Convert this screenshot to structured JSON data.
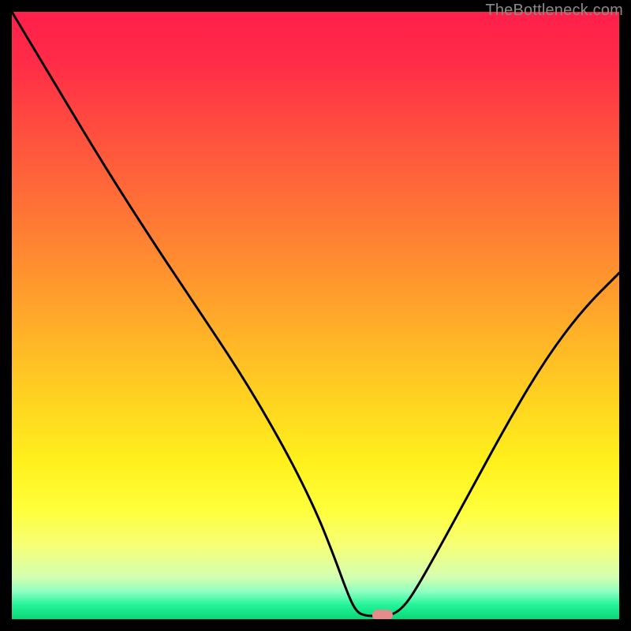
{
  "watermark": "TheBottleneck.com",
  "colors": {
    "frame": "#000000",
    "marker": "#e58b8c",
    "gradient_stops": [
      {
        "offset": 0.0,
        "color": "#ff1f4b"
      },
      {
        "offset": 0.08,
        "color": "#ff2b47"
      },
      {
        "offset": 0.2,
        "color": "#ff4f3f"
      },
      {
        "offset": 0.35,
        "color": "#ff7a34"
      },
      {
        "offset": 0.5,
        "color": "#ffa82a"
      },
      {
        "offset": 0.63,
        "color": "#ffd021"
      },
      {
        "offset": 0.74,
        "color": "#fff01c"
      },
      {
        "offset": 0.82,
        "color": "#ffff3a"
      },
      {
        "offset": 0.88,
        "color": "#f6ff78"
      },
      {
        "offset": 0.93,
        "color": "#d4ffb0"
      },
      {
        "offset": 0.955,
        "color": "#8dffc0"
      },
      {
        "offset": 0.975,
        "color": "#28f59a"
      },
      {
        "offset": 1.0,
        "color": "#08d877"
      }
    ]
  },
  "chart_data": {
    "type": "line",
    "title": "",
    "xlabel": "",
    "ylabel": "",
    "xlim": [
      0,
      100
    ],
    "ylim": [
      0,
      100
    ],
    "series": [
      {
        "name": "bottleneck-curve",
        "points": [
          {
            "x": 0.0,
            "y": 100.0
          },
          {
            "x": 6.0,
            "y": 90.0
          },
          {
            "x": 15.0,
            "y": 75.0
          },
          {
            "x": 23.0,
            "y": 62.5
          },
          {
            "x": 30.0,
            "y": 52.0
          },
          {
            "x": 38.0,
            "y": 40.0
          },
          {
            "x": 45.0,
            "y": 28.0
          },
          {
            "x": 50.0,
            "y": 18.0
          },
          {
            "x": 53.0,
            "y": 10.5
          },
          {
            "x": 55.0,
            "y": 5.0
          },
          {
            "x": 56.5,
            "y": 1.5
          },
          {
            "x": 58.0,
            "y": 0.5
          },
          {
            "x": 62.0,
            "y": 0.5
          },
          {
            "x": 64.0,
            "y": 1.5
          },
          {
            "x": 66.0,
            "y": 4.0
          },
          {
            "x": 70.0,
            "y": 11.0
          },
          {
            "x": 76.0,
            "y": 22.0
          },
          {
            "x": 82.0,
            "y": 33.0
          },
          {
            "x": 88.0,
            "y": 43.0
          },
          {
            "x": 94.0,
            "y": 51.0
          },
          {
            "x": 100.0,
            "y": 57.0
          }
        ]
      }
    ],
    "marker": {
      "x": 61.0,
      "y": 0.6
    }
  }
}
